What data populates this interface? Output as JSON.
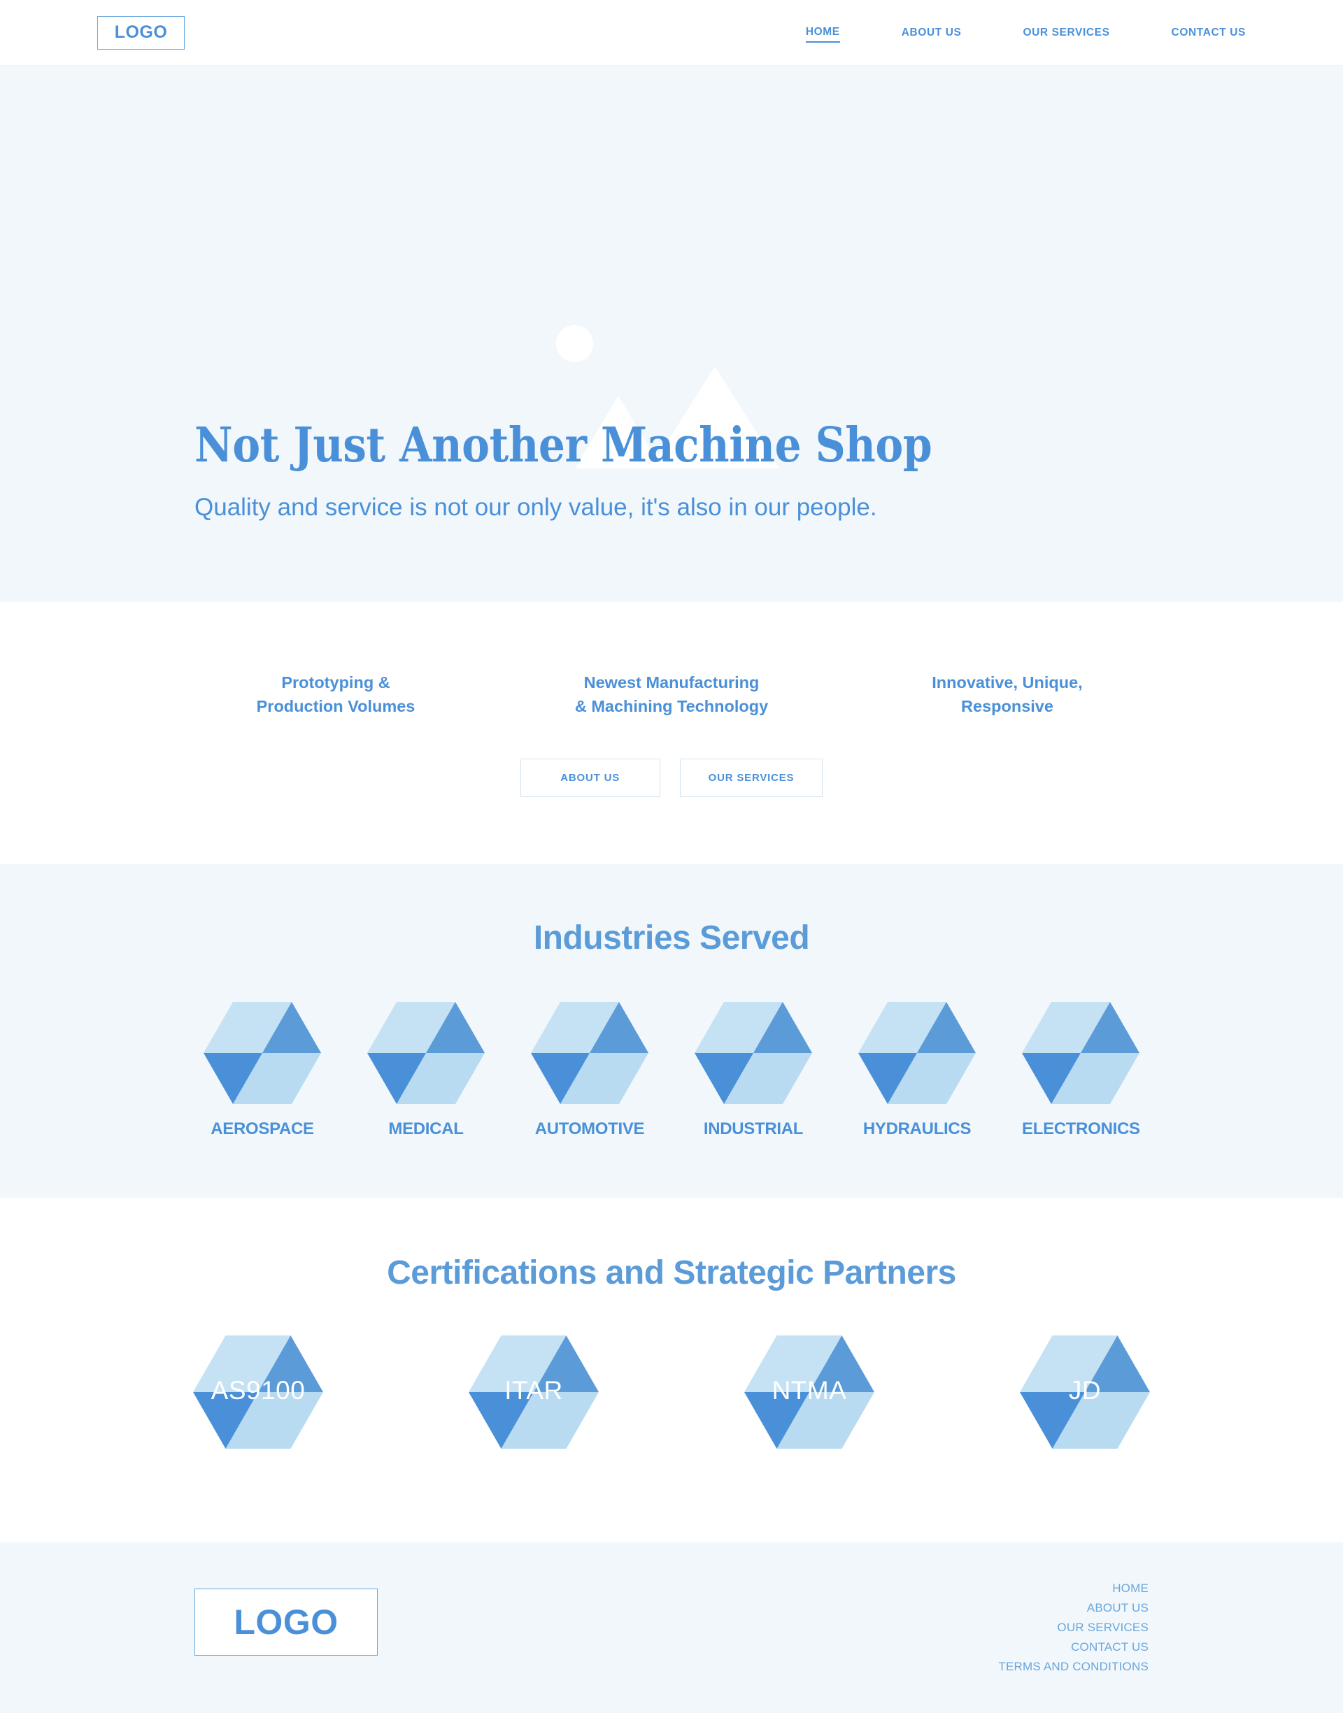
{
  "colors": {
    "accent": "#4a90d9",
    "accent_light": "#b8dbf2",
    "accent_mid": "#5b9bd8",
    "section_bg": "#f1f7fb",
    "page_bg": "#ffffff"
  },
  "header": {
    "logo_text": "LOGO",
    "nav": [
      {
        "label": "HOME",
        "active": true
      },
      {
        "label": "ABOUT US",
        "active": false
      },
      {
        "label": "OUR SERVICES",
        "active": false
      },
      {
        "label": "CONTACT US",
        "active": false
      }
    ]
  },
  "hero": {
    "title": "Not Just Another Machine Shop",
    "subtitle": "Quality and service is not our only value, it's also in our people."
  },
  "features": {
    "columns": [
      {
        "line1": "Prototyping &",
        "line2": "Production Volumes"
      },
      {
        "line1": "Newest Manufacturing",
        "line2": "& Machining Technology"
      },
      {
        "line1": "Innovative, Unique,",
        "line2": "Responsive"
      }
    ],
    "buttons": [
      {
        "label": "ABOUT US"
      },
      {
        "label": "OUR SERVICES"
      }
    ]
  },
  "industries": {
    "title": "Industries Served",
    "items": [
      {
        "label": "AEROSPACE"
      },
      {
        "label": "MEDICAL"
      },
      {
        "label": "AUTOMOTIVE"
      },
      {
        "label": "INDUSTRIAL"
      },
      {
        "label": "HYDRAULICS"
      },
      {
        "label": "ELECTRONICS"
      }
    ]
  },
  "certifications": {
    "title": "Certifications and Strategic Partners",
    "items": [
      {
        "label": "AS9100"
      },
      {
        "label": "ITAR"
      },
      {
        "label": "NTMA"
      },
      {
        "label": "JD"
      }
    ]
  },
  "footer": {
    "logo_text": "LOGO",
    "links": [
      {
        "label": "HOME"
      },
      {
        "label": "ABOUT US"
      },
      {
        "label": "OUR SERVICES"
      },
      {
        "label": "CONTACT US"
      },
      {
        "label": "TERMS AND CONDITIONS"
      }
    ]
  }
}
